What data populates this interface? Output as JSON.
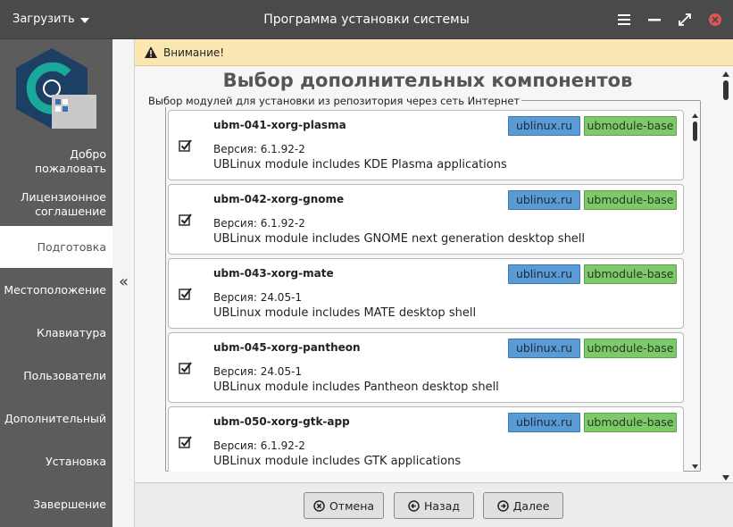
{
  "titlebar": {
    "menu_label": "Загрузить",
    "title": "Программа установки системы"
  },
  "sidebar": {
    "items": [
      {
        "label": "Добро пожаловать",
        "active": false
      },
      {
        "label": "Лицензионное соглашение",
        "active": false
      },
      {
        "label": "Подготовка",
        "active": true
      },
      {
        "label": "Местоположение",
        "active": false
      },
      {
        "label": "Клавиатура",
        "active": false
      },
      {
        "label": "Пользователи",
        "active": false
      },
      {
        "label": "Дополнительный",
        "active": false
      },
      {
        "label": "Установка",
        "active": false
      },
      {
        "label": "Завершение",
        "active": false
      }
    ],
    "collapse_glyph": "«"
  },
  "warning": {
    "text": "Внимание!"
  },
  "main": {
    "title": "Выбор дополнительных компонентов",
    "frame_label": "Выбор модулей для установки из репозитория через сеть Интернет",
    "version_prefix": "Версия:",
    "modules": [
      {
        "name": "ubm-041-xorg-plasma",
        "version": "6.1.92-2",
        "description": "UBLinux module includes KDE Plasma applications",
        "repo": "ublinux.ru",
        "category": "ubmodule-base",
        "checked": true
      },
      {
        "name": "ubm-042-xorg-gnome",
        "version": "6.1.92-2",
        "description": "UBLinux module includes GNOME next generation desktop shell",
        "repo": "ublinux.ru",
        "category": "ubmodule-base",
        "checked": true
      },
      {
        "name": "ubm-043-xorg-mate",
        "version": "24.05-1",
        "description": "UBLinux module includes MATE desktop shell",
        "repo": "ublinux.ru",
        "category": "ubmodule-base",
        "checked": true
      },
      {
        "name": "ubm-045-xorg-pantheon",
        "version": "24.05-1",
        "description": "UBLinux module includes Pantheon desktop shell",
        "repo": "ublinux.ru",
        "category": "ubmodule-base",
        "checked": true
      },
      {
        "name": "ubm-050-xorg-gtk-app",
        "version": "6.1.92-2",
        "description": "UBLinux module includes GTK applications",
        "repo": "ublinux.ru",
        "category": "ubmodule-base",
        "checked": true
      }
    ]
  },
  "footer": {
    "cancel_label": "Отмена",
    "back_label": "Назад",
    "next_label": "Далее"
  },
  "colors": {
    "warning_bg": "#fbe7b2",
    "repo_tag": "#5b9bd5",
    "category_tag": "#7fc86c",
    "close_button": "#e05555",
    "logo_teal": "#1aa89a",
    "logo_navy": "#1d3f63"
  }
}
